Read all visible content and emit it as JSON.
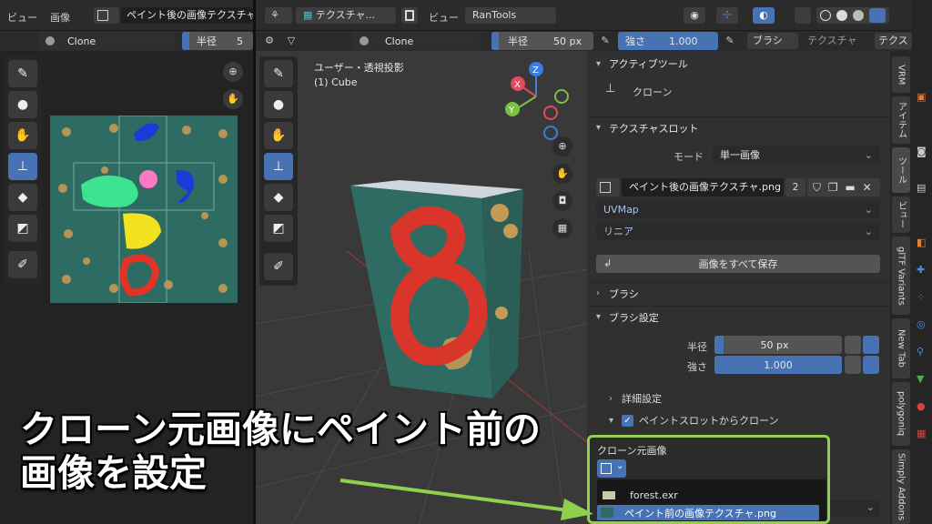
{
  "left_editor": {
    "menu_view": "ビュー",
    "menu_image": "画像",
    "image_name": "ペイント後の画像テクスチャ.",
    "brush_name": "Clone",
    "radius_label": "半径",
    "radius_value": "5"
  },
  "top_bar": {
    "texture_dropdown": "テクスチャ...",
    "menu_view": "ビュー",
    "rantools": "RanTools"
  },
  "tool_header": {
    "brush_name": "Clone",
    "radius_label": "半径",
    "radius_value": "50 px",
    "strength_label": "強さ",
    "strength_value": "1.000",
    "brush_tab": "ブラシ",
    "texture_tab": "テクスチャ",
    "texture_tab2": "テクス"
  },
  "viewport": {
    "projection": "ユーザー・透視投影",
    "object": "(1) Cube",
    "axis_x": "X",
    "axis_y": "Y",
    "axis_z": "Z",
    "cube_number": "8"
  },
  "properties": {
    "active_tool_head": "アクティブツール",
    "active_tool_name": "クローン",
    "texture_slot_head": "テクスチャスロット",
    "mode_label": "モード",
    "mode_value": "単一画像",
    "image_name": "ペイント後の画像テクスチャ.png",
    "user_count": "2",
    "uvmap": "UVMap",
    "interp": "リニア",
    "save_all": "画像をすべて保存",
    "brush_head": "ブラシ",
    "brush_settings_head": "ブラシ設定",
    "radius_label": "半径",
    "radius_value": "50 px",
    "strength_label": "強さ",
    "strength_value": "1.000",
    "advanced": "詳細設定",
    "clone_from_slot": "ペイントスロットからクローン",
    "clone_source_label": "クローン元画像",
    "dropdown_items": [
      "forest.exr",
      "ペイント前の画像テクスチャ.png"
    ]
  },
  "vertical_tabs": [
    "VRM",
    "アイテム",
    "ツール",
    "ビュー",
    "glTF Variants",
    "New Tab",
    "polygoniq",
    "Simply Addons"
  ],
  "caption": {
    "line1": "クローン元画像にペイント前の",
    "line2": "画像を設定"
  },
  "colors": {
    "accent_blue": "#4772b3",
    "highlight_green": "#8fd14f",
    "texture_teal": "#2e6b62",
    "paint_red": "#d9352a"
  }
}
